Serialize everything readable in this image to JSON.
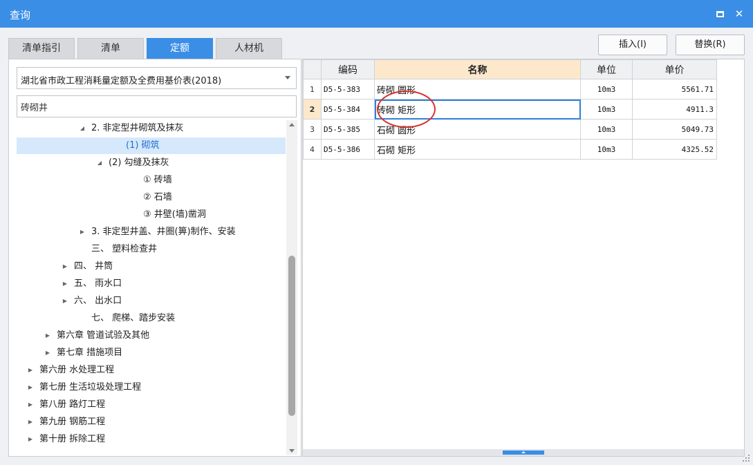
{
  "window": {
    "title": "查询"
  },
  "tabs": [
    {
      "label": "清单指引"
    },
    {
      "label": "清单"
    },
    {
      "label": "定额"
    },
    {
      "label": "人材机"
    }
  ],
  "toolbar": {
    "insert_label": "插入(I)",
    "replace_label": "替换(R)"
  },
  "left": {
    "library": "湖北省市政工程消耗量定额及全费用基价表(2018)",
    "search_value": "砖砌井"
  },
  "tree": [
    {
      "label": "2. 非定型井砌筑及抹灰",
      "toggle": "expanded"
    },
    {
      "label": "(1) 砌筑",
      "toggle": "none",
      "selected": true
    },
    {
      "label": "(2) 勾缝及抹灰",
      "toggle": "expanded"
    },
    {
      "label": "① 砖墙",
      "toggle": "none"
    },
    {
      "label": "② 石墙",
      "toggle": "none"
    },
    {
      "label": "③ 井壁(墙)凿洞",
      "toggle": "none"
    },
    {
      "label": "3. 非定型井盖、井圈(箅)制作、安装",
      "toggle": "collapsed"
    },
    {
      "label": "三、 塑料检查井",
      "toggle": "none"
    },
    {
      "label": "四、 井筒",
      "toggle": "collapsed"
    },
    {
      "label": "五、 雨水口",
      "toggle": "collapsed"
    },
    {
      "label": "六、 出水口",
      "toggle": "collapsed"
    },
    {
      "label": "七、 爬梯、踏步安装",
      "toggle": "none"
    },
    {
      "label": "第六章 管道试验及其他",
      "toggle": "collapsed"
    },
    {
      "label": "第七章 措施项目",
      "toggle": "collapsed"
    },
    {
      "label": "第六册 水处理工程",
      "toggle": "collapsed"
    },
    {
      "label": "第七册 生活垃圾处理工程",
      "toggle": "collapsed"
    },
    {
      "label": "第八册 路灯工程",
      "toggle": "collapsed"
    },
    {
      "label": "第九册 钢筋工程",
      "toggle": "collapsed"
    },
    {
      "label": "第十册 拆除工程",
      "toggle": "collapsed"
    }
  ],
  "table": {
    "headers": {
      "code": "编码",
      "name": "名称",
      "unit": "单位",
      "price": "单价"
    },
    "rows": [
      {
        "num": "1",
        "code": "D5-5-383",
        "name": "砖砌 圆形",
        "unit": "10m3",
        "price": "5561.71"
      },
      {
        "num": "2",
        "code": "D5-5-384",
        "name": "砖砌 矩形",
        "unit": "10m3",
        "price": "4911.3",
        "selected": true
      },
      {
        "num": "3",
        "code": "D5-5-385",
        "name": "石砌 圆形",
        "unit": "10m3",
        "price": "5049.73"
      },
      {
        "num": "4",
        "code": "D5-5-386",
        "name": "石砌 矩形",
        "unit": "10m3",
        "price": "4325.52"
      }
    ]
  }
}
